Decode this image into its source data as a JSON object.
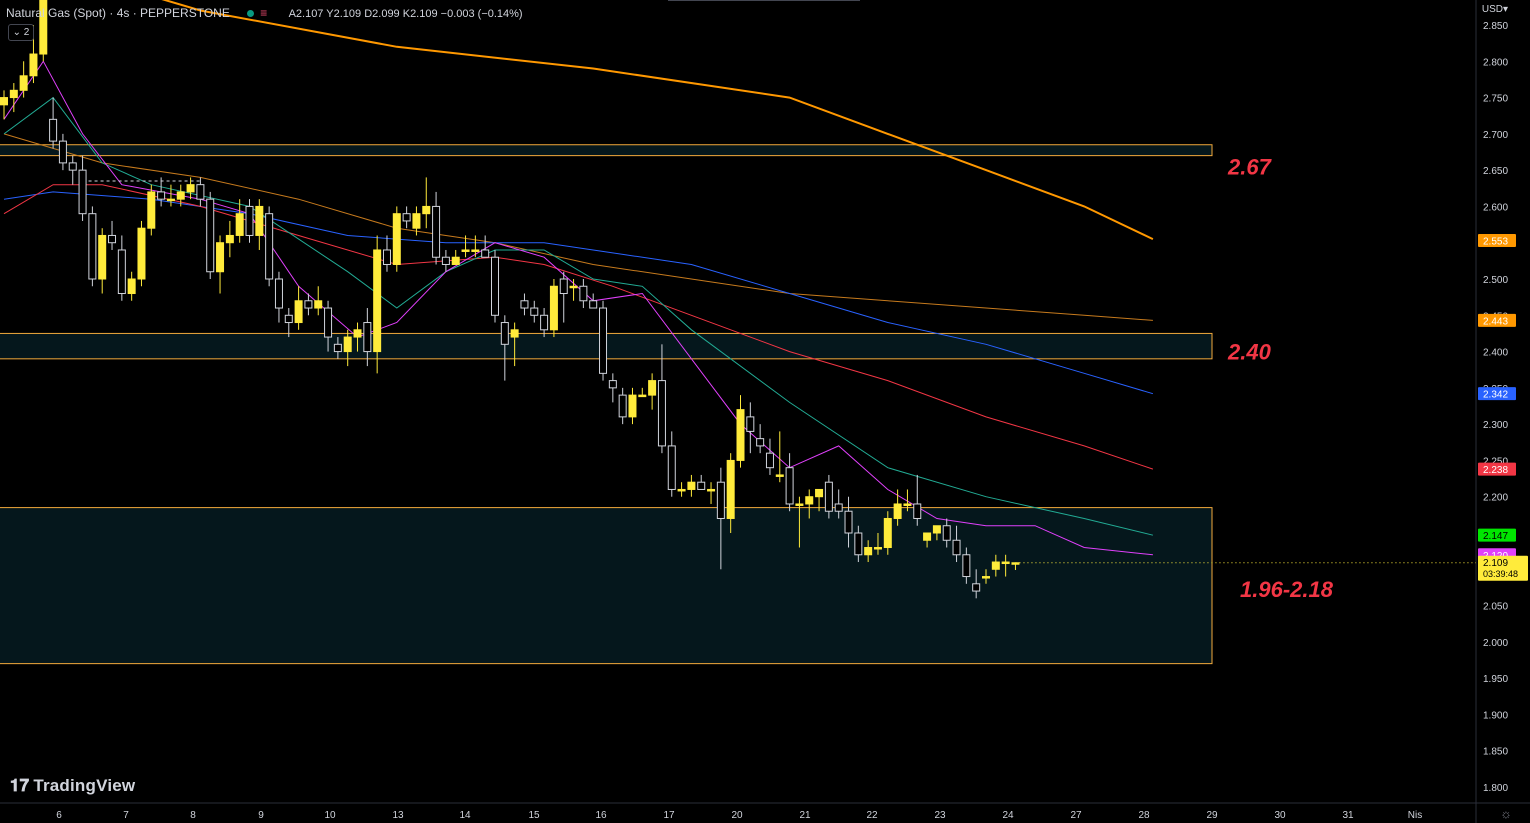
{
  "header": {
    "symbol": "Natural Gas (Spot) · 4s · PEPPERSTONE",
    "ohlc": "A2.107 Y2.109 D2.099 K2.109 −0.003 (−0.14%)",
    "indicators_collapsed_count": "2"
  },
  "axis": {
    "currency": "USD"
  },
  "branding": {
    "logo_text": "TradingView",
    "icon": "tradingview-logo"
  },
  "settings": {
    "icon": "gear-icon"
  },
  "chart_data": {
    "type": "candlestick",
    "y_axis": {
      "min": 1.77,
      "max": 2.875,
      "ticks": [
        "2.850",
        "2.800",
        "2.750",
        "2.700",
        "2.650",
        "2.600",
        "2.550",
        "2.500",
        "2.450",
        "2.400",
        "2.350",
        "2.300",
        "2.250",
        "2.200",
        "2.150",
        "2.100",
        "2.050",
        "2.000",
        "1.950",
        "1.900",
        "1.850",
        "1.800"
      ]
    },
    "x_axis": {
      "labels": [
        "6",
        "7",
        "8",
        "9",
        "10",
        "13",
        "14",
        "15",
        "16",
        "17",
        "20",
        "21",
        "22",
        "23",
        "24",
        "27",
        "28",
        "29",
        "30",
        "31",
        "Nis"
      ]
    },
    "candles": [
      [
        2.74,
        2.76,
        2.72,
        2.75
      ],
      [
        2.75,
        2.77,
        2.73,
        2.76
      ],
      [
        2.76,
        2.8,
        2.75,
        2.78
      ],
      [
        2.78,
        2.85,
        2.77,
        2.81
      ],
      [
        2.81,
        2.95,
        2.8,
        2.92
      ],
      [
        2.72,
        2.75,
        2.68,
        2.69
      ],
      [
        2.69,
        2.7,
        2.65,
        2.66
      ],
      [
        2.66,
        2.67,
        2.63,
        2.65
      ],
      [
        2.65,
        2.67,
        2.58,
        2.59
      ],
      [
        2.59,
        2.6,
        2.49,
        2.5
      ],
      [
        2.5,
        2.57,
        2.48,
        2.56
      ],
      [
        2.56,
        2.58,
        2.54,
        2.55
      ],
      [
        2.54,
        2.56,
        2.47,
        2.48
      ],
      [
        2.48,
        2.51,
        2.47,
        2.5
      ],
      [
        2.5,
        2.58,
        2.49,
        2.57
      ],
      [
        2.57,
        2.63,
        2.56,
        2.62
      ],
      [
        2.62,
        2.64,
        2.6,
        2.61
      ],
      [
        2.61,
        2.63,
        2.6,
        2.61
      ],
      [
        2.61,
        2.63,
        2.6,
        2.62
      ],
      [
        2.62,
        2.64,
        2.61,
        2.63
      ],
      [
        2.63,
        2.64,
        2.6,
        2.61
      ],
      [
        2.61,
        2.62,
        2.5,
        2.51
      ],
      [
        2.51,
        2.56,
        2.48,
        2.55
      ],
      [
        2.55,
        2.58,
        2.53,
        2.56
      ],
      [
        2.56,
        2.61,
        2.55,
        2.59
      ],
      [
        2.6,
        2.61,
        2.55,
        2.56
      ],
      [
        2.56,
        2.61,
        2.54,
        2.6
      ],
      [
        2.59,
        2.6,
        2.49,
        2.5
      ],
      [
        2.5,
        2.51,
        2.44,
        2.46
      ],
      [
        2.45,
        2.46,
        2.42,
        2.44
      ],
      [
        2.44,
        2.49,
        2.43,
        2.47
      ],
      [
        2.47,
        2.48,
        2.45,
        2.46
      ],
      [
        2.46,
        2.49,
        2.45,
        2.47
      ],
      [
        2.46,
        2.47,
        2.4,
        2.42
      ],
      [
        2.41,
        2.42,
        2.39,
        2.4
      ],
      [
        2.4,
        2.43,
        2.38,
        2.42
      ],
      [
        2.42,
        2.44,
        2.4,
        2.43
      ],
      [
        2.44,
        2.46,
        2.38,
        2.4
      ],
      [
        2.4,
        2.56,
        2.37,
        2.54
      ],
      [
        2.54,
        2.56,
        2.51,
        2.52
      ],
      [
        2.52,
        2.6,
        2.51,
        2.59
      ],
      [
        2.59,
        2.6,
        2.57,
        2.58
      ],
      [
        2.57,
        2.6,
        2.56,
        2.59
      ],
      [
        2.59,
        2.64,
        2.57,
        2.6
      ],
      [
        2.6,
        2.62,
        2.52,
        2.53
      ],
      [
        2.53,
        2.54,
        2.51,
        2.52
      ],
      [
        2.52,
        2.54,
        2.52,
        2.53
      ],
      [
        2.54,
        2.56,
        2.53,
        2.54
      ],
      [
        2.54,
        2.56,
        2.53,
        2.54
      ],
      [
        2.54,
        2.56,
        2.53,
        2.53
      ],
      [
        2.53,
        2.54,
        2.44,
        2.45
      ],
      [
        2.44,
        2.45,
        2.36,
        2.41
      ],
      [
        2.42,
        2.44,
        2.38,
        2.43
      ],
      [
        2.47,
        2.48,
        2.45,
        2.46
      ],
      [
        2.46,
        2.47,
        2.44,
        2.45
      ],
      [
        2.45,
        2.46,
        2.42,
        2.43
      ],
      [
        2.43,
        2.5,
        2.42,
        2.49
      ],
      [
        2.5,
        2.51,
        2.44,
        2.48
      ],
      [
        2.49,
        2.5,
        2.47,
        2.49
      ],
      [
        2.49,
        2.5,
        2.46,
        2.47
      ],
      [
        2.47,
        2.48,
        2.46,
        2.46
      ],
      [
        2.46,
        2.47,
        2.36,
        2.37
      ],
      [
        2.36,
        2.37,
        2.33,
        2.35
      ],
      [
        2.34,
        2.35,
        2.3,
        2.31
      ],
      [
        2.31,
        2.35,
        2.3,
        2.34
      ],
      [
        2.34,
        2.35,
        2.34,
        2.34
      ],
      [
        2.34,
        2.37,
        2.32,
        2.36
      ],
      [
        2.36,
        2.41,
        2.26,
        2.27
      ],
      [
        2.27,
        2.29,
        2.2,
        2.21
      ],
      [
        2.21,
        2.22,
        2.2,
        2.21
      ],
      [
        2.21,
        2.23,
        2.2,
        2.22
      ],
      [
        2.22,
        2.23,
        2.21,
        2.21
      ],
      [
        2.21,
        2.22,
        2.19,
        2.21
      ],
      [
        2.22,
        2.24,
        2.1,
        2.17
      ],
      [
        2.17,
        2.26,
        2.15,
        2.25
      ],
      [
        2.25,
        2.34,
        2.24,
        2.32
      ],
      [
        2.31,
        2.33,
        2.26,
        2.29
      ],
      [
        2.28,
        2.3,
        2.26,
        2.27
      ],
      [
        2.26,
        2.28,
        2.23,
        2.24
      ],
      [
        2.23,
        2.29,
        2.22,
        2.23
      ],
      [
        2.24,
        2.26,
        2.18,
        2.19
      ],
      [
        2.19,
        2.2,
        2.13,
        2.19
      ],
      [
        2.19,
        2.21,
        2.17,
        2.2
      ],
      [
        2.2,
        2.21,
        2.18,
        2.21
      ],
      [
        2.22,
        2.23,
        2.17,
        2.18
      ],
      [
        2.19,
        2.21,
        2.17,
        2.18
      ],
      [
        2.18,
        2.2,
        2.13,
        2.15
      ],
      [
        2.15,
        2.16,
        2.11,
        2.12
      ],
      [
        2.12,
        2.14,
        2.11,
        2.13
      ],
      [
        2.13,
        2.15,
        2.12,
        2.13
      ],
      [
        2.13,
        2.18,
        2.12,
        2.17
      ],
      [
        2.17,
        2.21,
        2.16,
        2.19
      ],
      [
        2.19,
        2.21,
        2.18,
        2.19
      ],
      [
        2.19,
        2.23,
        2.16,
        2.17
      ],
      [
        2.14,
        2.15,
        2.13,
        2.15
      ],
      [
        2.15,
        2.16,
        2.14,
        2.16
      ],
      [
        2.16,
        2.17,
        2.13,
        2.14
      ],
      [
        2.14,
        2.16,
        2.11,
        2.12
      ],
      [
        2.12,
        2.13,
        2.08,
        2.09
      ],
      [
        2.08,
        2.1,
        2.06,
        2.07
      ],
      [
        2.09,
        2.1,
        2.08,
        2.09
      ],
      [
        2.1,
        2.12,
        2.09,
        2.11
      ],
      [
        2.11,
        2.12,
        2.09,
        2.11
      ],
      [
        2.107,
        2.109,
        2.099,
        2.109
      ]
    ],
    "moving_averages": [
      {
        "color": "#ff9800",
        "width": 2,
        "points": [
          [
            0,
            2.95
          ],
          [
            20,
            2.87
          ],
          [
            40,
            2.82
          ],
          [
            60,
            2.79
          ],
          [
            80,
            2.75
          ],
          [
            90,
            2.7
          ],
          [
            100,
            2.65
          ],
          [
            110,
            2.6
          ],
          [
            117,
            2.555
          ]
        ]
      },
      {
        "color": "#c67a1d",
        "width": 1,
        "points": [
          [
            0,
            2.7
          ],
          [
            10,
            2.66
          ],
          [
            20,
            2.64
          ],
          [
            30,
            2.61
          ],
          [
            40,
            2.57
          ],
          [
            50,
            2.55
          ],
          [
            60,
            2.52
          ],
          [
            70,
            2.5
          ],
          [
            80,
            2.48
          ],
          [
            90,
            2.47
          ],
          [
            100,
            2.46
          ],
          [
            110,
            2.45
          ],
          [
            117,
            2.443
          ]
        ]
      },
      {
        "color": "#2962ff",
        "width": 1,
        "points": [
          [
            0,
            2.61
          ],
          [
            5,
            2.62
          ],
          [
            15,
            2.61
          ],
          [
            25,
            2.59
          ],
          [
            35,
            2.56
          ],
          [
            45,
            2.55
          ],
          [
            55,
            2.55
          ],
          [
            60,
            2.54
          ],
          [
            70,
            2.52
          ],
          [
            80,
            2.48
          ],
          [
            90,
            2.44
          ],
          [
            100,
            2.41
          ],
          [
            110,
            2.37
          ],
          [
            117,
            2.342
          ]
        ]
      },
      {
        "color": "#f23645",
        "width": 1,
        "points": [
          [
            0,
            2.59
          ],
          [
            5,
            2.63
          ],
          [
            10,
            2.63
          ],
          [
            20,
            2.6
          ],
          [
            30,
            2.56
          ],
          [
            40,
            2.52
          ],
          [
            50,
            2.53
          ],
          [
            55,
            2.52
          ],
          [
            62,
            2.49
          ],
          [
            70,
            2.45
          ],
          [
            80,
            2.4
          ],
          [
            90,
            2.36
          ],
          [
            100,
            2.31
          ],
          [
            110,
            2.27
          ],
          [
            117,
            2.238
          ]
        ]
      },
      {
        "color": "#22ab94",
        "width": 1,
        "points": [
          [
            0,
            2.7
          ],
          [
            5,
            2.75
          ],
          [
            10,
            2.66
          ],
          [
            15,
            2.63
          ],
          [
            25,
            2.6
          ],
          [
            35,
            2.51
          ],
          [
            40,
            2.46
          ],
          [
            45,
            2.51
          ],
          [
            50,
            2.54
          ],
          [
            55,
            2.54
          ],
          [
            60,
            2.5
          ],
          [
            65,
            2.49
          ],
          [
            70,
            2.43
          ],
          [
            80,
            2.33
          ],
          [
            90,
            2.24
          ],
          [
            100,
            2.2
          ],
          [
            110,
            2.17
          ],
          [
            117,
            2.147
          ]
        ]
      },
      {
        "color": "#e040fb",
        "width": 1,
        "points": [
          [
            0,
            2.72
          ],
          [
            4,
            2.8
          ],
          [
            8,
            2.7
          ],
          [
            12,
            2.63
          ],
          [
            20,
            2.61
          ],
          [
            25,
            2.59
          ],
          [
            30,
            2.49
          ],
          [
            36,
            2.42
          ],
          [
            40,
            2.44
          ],
          [
            45,
            2.51
          ],
          [
            50,
            2.55
          ],
          [
            55,
            2.53
          ],
          [
            60,
            2.47
          ],
          [
            65,
            2.48
          ],
          [
            70,
            2.39
          ],
          [
            75,
            2.3
          ],
          [
            80,
            2.24
          ],
          [
            85,
            2.27
          ],
          [
            90,
            2.21
          ],
          [
            95,
            2.17
          ],
          [
            100,
            2.16
          ],
          [
            105,
            2.16
          ],
          [
            110,
            2.13
          ],
          [
            117,
            2.12
          ]
        ]
      }
    ],
    "zones": [
      {
        "label": "2.67",
        "top": 2.685,
        "bottom": 2.67,
        "label_price": 2.655
      },
      {
        "label": "2.40",
        "top": 2.425,
        "bottom": 2.39,
        "label_price": 2.4
      },
      {
        "label": "1.96-2.18",
        "top": 2.185,
        "bottom": 1.97,
        "label_price": 2.073
      }
    ],
    "price_tags": [
      {
        "value": "2.553",
        "price": 2.553,
        "color": "#ff9800"
      },
      {
        "value": "2.443",
        "price": 2.443,
        "color": "#ff9800"
      },
      {
        "value": "2.342",
        "price": 2.342,
        "color": "#2962ff"
      },
      {
        "value": "2.238",
        "price": 2.238,
        "color": "#f23645"
      },
      {
        "value": "2.147",
        "price": 2.147,
        "color": "#00e600"
      },
      {
        "value": "2.120",
        "price": 2.12,
        "color": "#e040fb"
      }
    ],
    "last_price": {
      "value": "2.109",
      "countdown": "03:39:48",
      "price": 2.109,
      "color": "#ffeb3b"
    }
  }
}
